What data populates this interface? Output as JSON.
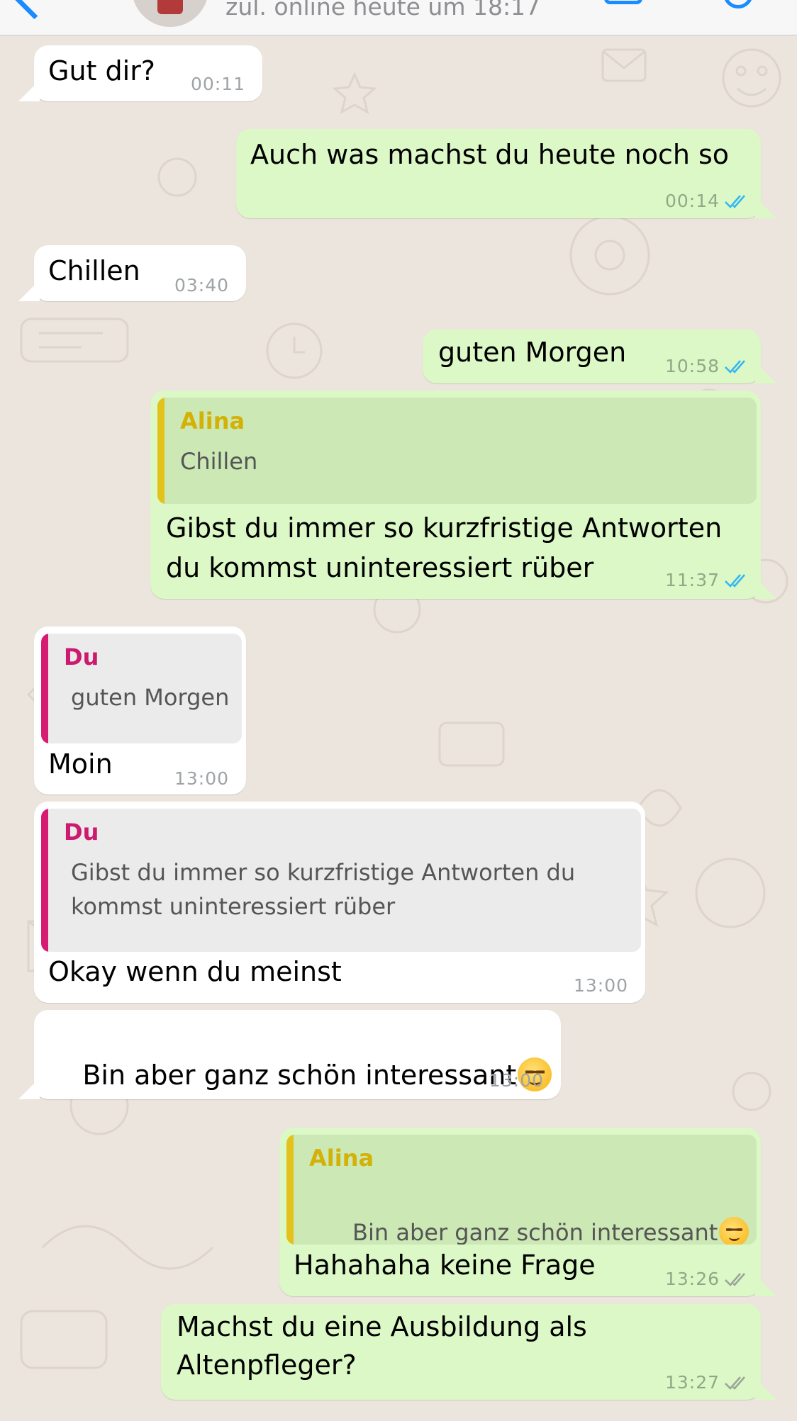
{
  "header": {
    "status_text": "zul. online heute um 18:17"
  },
  "messages": [
    {
      "id": "m1",
      "text": "Gut dir?",
      "time": "00:11"
    },
    {
      "id": "m2",
      "text": "Auch was machst du heute noch so",
      "time": "00:14",
      "read": true
    },
    {
      "id": "m3",
      "text": "Chillen",
      "time": "03:40"
    },
    {
      "id": "m4",
      "text": "guten Morgen",
      "time": "10:58",
      "read": true
    },
    {
      "id": "m5",
      "quote_author": "Alina",
      "quote_text": "Chillen",
      "text_line1": "Gibst du immer so kurzfristige Antworten",
      "text_line2": "du kommst uninteressiert rüber",
      "time": "11:37",
      "read": true
    },
    {
      "id": "m6",
      "quote_author": "Du",
      "quote_text": "guten Morgen",
      "text": "Moin",
      "time": "13:00"
    },
    {
      "id": "m7",
      "quote_author": "Du",
      "quote_line1": "Gibst du immer so kurzfristige Antworten du",
      "quote_line2": "kommst uninteressiert rüber",
      "text": "Okay wenn du meinst",
      "time": "13:00"
    },
    {
      "id": "m8",
      "text": "Bin aber ganz schön interessant",
      "emoji": "😌",
      "time": "13:00"
    },
    {
      "id": "m9",
      "quote_author": "Alina",
      "quote_text": "Bin aber ganz schön interessant",
      "quote_emoji": "😌",
      "text": "Hahahaha keine Frage",
      "time": "13:26",
      "read": false
    },
    {
      "id": "m10",
      "text_line1": "Machst du eine Ausbildung als",
      "text_line2": "Altenpfleger?",
      "time": "13:27",
      "read": false
    }
  ],
  "colors": {
    "chat_background": "#ece5dd",
    "incoming_bubble": "#ffffff",
    "outgoing_bubble": "#dcf8c6",
    "read_ticks": "#34b7f1",
    "delivered_ticks": "#9aa59a",
    "accent": "#1a8cff",
    "quote_author_alina": "#d4b106",
    "quote_author_du": "#cc1a6f"
  },
  "icons": [
    "back-chevron-icon",
    "video-call-icon",
    "voice-call-icon",
    "double-check-icon",
    "relieved-face-emoji"
  ]
}
